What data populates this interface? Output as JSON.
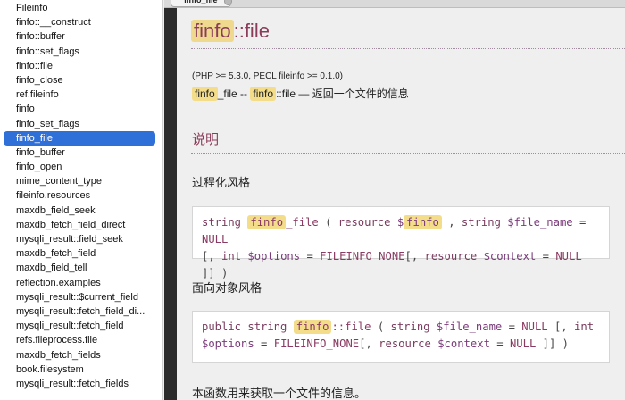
{
  "sidebar": {
    "selected_index": 10,
    "items": [
      "Fileinfo",
      "finfo::__construct",
      "finfo::buffer",
      "finfo::set_flags",
      "finfo::file",
      "finfo_close",
      "ref.fileinfo",
      "finfo",
      "finfo_set_flags",
      "finfo_file",
      "finfo_buffer",
      "finfo_open",
      "mime_content_type",
      "fileinfo.resources",
      "maxdb_field_seek",
      "maxdb_fetch_field_direct",
      "mysqli_result::field_seek",
      "maxdb_fetch_field",
      "maxdb_field_tell",
      "reflection.examples",
      "mysqli_result::$current_field",
      "mysqli_result::fetch_field_di...",
      "mysqli_result::fetch_field",
      "refs.fileprocess.file",
      "maxdb_fetch_fields",
      "book.filesystem",
      "mysqli_result::fetch_fields"
    ]
  },
  "tab": {
    "label": "finfo_file"
  },
  "doc": {
    "title_hl": "finfo",
    "title_rest": "::file",
    "version": "(PHP >= 5.3.0, PECL fileinfo >= 0.1.0)",
    "refname": {
      "a_hl": "finfo",
      "a_rest": "_file -- ",
      "b_hl": "finfo",
      "b_rest": "::file — 返回一个文件的信息"
    },
    "section_title": "说明",
    "procedural_label": "过程化风格",
    "oo_label": "面向对象风格",
    "description": "本函数用来获取一个文件的信息。",
    "proc_sig": {
      "type": "string",
      "fn_hl": "finfo",
      "fn_rest": "_file",
      "p1_type": "resource",
      "p1_dollar": "$",
      "p1_hl": "finfo",
      "p2_type": "string",
      "p2_var": "$file_name",
      "p2_default": "NULL",
      "p3_type": "int",
      "p3_var": "$options",
      "p3_default": "FILEINFO_NONE",
      "p4_type": "resource",
      "p4_var": "$context",
      "p4_default": "NULL"
    },
    "oo_sig": {
      "mod": "public",
      "type": "string",
      "fn_hl": "finfo",
      "fn_rest": "::file",
      "p1_type": "string",
      "p1_var": "$file_name",
      "p1_default": "NULL",
      "p2_type": "int",
      "p2_var": "$options",
      "p2_default": "FILEINFO_NONE",
      "p3_type": "resource",
      "p3_var": "$context",
      "p3_default": "NULL"
    }
  }
}
